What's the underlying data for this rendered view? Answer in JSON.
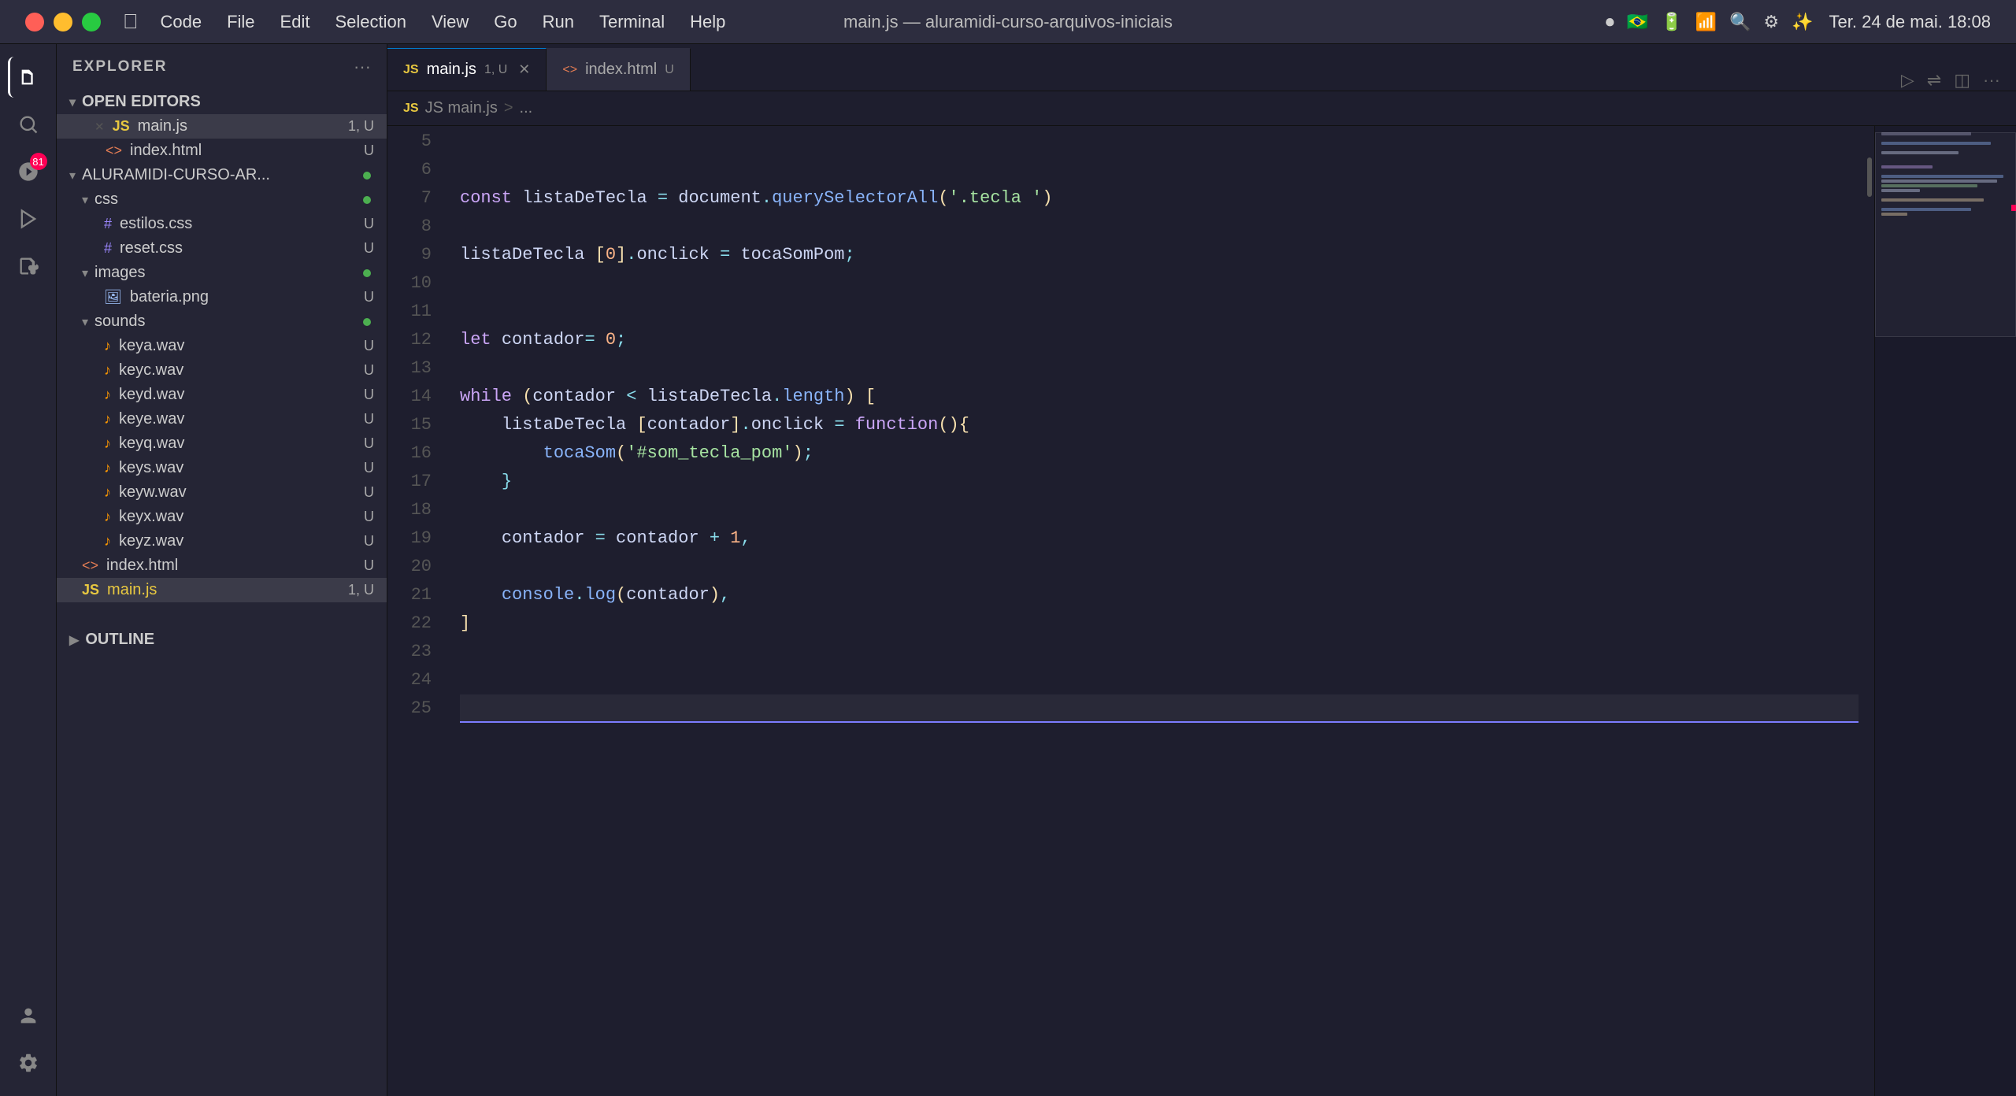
{
  "titlebar": {
    "title": "main.js — aluramidi-curso-arquivos-iniciais",
    "datetime": "Ter. 24 de mai.  18:08",
    "menu": [
      "",
      "Code",
      "File",
      "Edit",
      "Selection",
      "View",
      "Go",
      "Run",
      "Terminal",
      "Help"
    ]
  },
  "tabs": [
    {
      "id": "main-js",
      "label": "main.js",
      "badge": "1, U",
      "active": true,
      "closeable": true,
      "icon": "JS"
    },
    {
      "id": "index-html",
      "label": "index.html",
      "badge": "U",
      "active": false,
      "closeable": false,
      "icon": "HTML"
    }
  ],
  "breadcrumb": {
    "items": [
      "JS main.js",
      ">",
      "..."
    ]
  },
  "sidebar": {
    "title": "EXPLORER",
    "sections": {
      "open_editors": {
        "label": "OPEN EDITORS",
        "files": [
          {
            "name": "main.js",
            "badge": "1, U",
            "icon": "JS",
            "active": true
          },
          {
            "name": "index.html",
            "badge": "U",
            "icon": "HTML"
          }
        ]
      },
      "project": {
        "label": "ALURAMIDI-CURSO-AR...",
        "folders": [
          {
            "name": "css",
            "level": 1,
            "dot": "green",
            "children": [
              {
                "name": "estilos.css",
                "badge": "U",
                "icon": "CSS"
              },
              {
                "name": "reset.css",
                "badge": "U",
                "icon": "CSS"
              }
            ]
          },
          {
            "name": "images",
            "level": 1,
            "dot": "green",
            "children": [
              {
                "name": "bateria.png",
                "badge": "U",
                "icon": "IMG"
              }
            ]
          },
          {
            "name": "sounds",
            "level": 1,
            "dot": "green",
            "children": [
              {
                "name": "keya.wav",
                "badge": "U",
                "icon": "AUDIO"
              },
              {
                "name": "keyc.wav",
                "badge": "U",
                "icon": "AUDIO"
              },
              {
                "name": "keyd.wav",
                "badge": "U",
                "icon": "AUDIO"
              },
              {
                "name": "keye.wav",
                "badge": "U",
                "icon": "AUDIO"
              },
              {
                "name": "keyq.wav",
                "badge": "U",
                "icon": "AUDIO"
              },
              {
                "name": "keys.wav",
                "badge": "U",
                "icon": "AUDIO"
              },
              {
                "name": "keyw.wav",
                "badge": "U",
                "icon": "AUDIO"
              },
              {
                "name": "keyx.wav",
                "badge": "U",
                "icon": "AUDIO"
              },
              {
                "name": "keyz.wav",
                "badge": "U",
                "icon": "AUDIO"
              }
            ]
          },
          {
            "name": "index.html",
            "level": 0,
            "badge": "U",
            "icon": "HTML"
          },
          {
            "name": "main.js",
            "level": 0,
            "badge": "1, U",
            "icon": "JS",
            "active": true
          }
        ]
      }
    }
  },
  "code": {
    "lines": [
      {
        "num": 5,
        "content": ""
      },
      {
        "num": 6,
        "content": ""
      },
      {
        "num": 7,
        "tokens": [
          {
            "t": "kw",
            "v": "const "
          },
          {
            "t": "var",
            "v": "listaDeTecla "
          },
          {
            "t": "op",
            "v": "= "
          },
          {
            "t": "var",
            "v": "document"
          },
          {
            "t": "op",
            "v": "."
          },
          {
            "t": "fn",
            "v": "querySelectorAll"
          },
          {
            "t": "bracket",
            "v": "("
          },
          {
            "t": "str",
            "v": "'.tecla '"
          },
          {
            "t": "bracket",
            "v": ")"
          }
        ]
      },
      {
        "num": 8,
        "content": ""
      },
      {
        "num": 9,
        "tokens": [
          {
            "t": "var",
            "v": "listaDeTecla "
          },
          {
            "t": "bracket",
            "v": "["
          },
          {
            "t": "num",
            "v": "0"
          },
          {
            "t": "bracket",
            "v": "]"
          },
          {
            "t": "op",
            "v": "."
          },
          {
            "t": "var",
            "v": "onclick "
          },
          {
            "t": "op",
            "v": "= "
          },
          {
            "t": "var",
            "v": "tocaSomPom"
          },
          {
            "t": "op",
            "v": ";"
          }
        ]
      },
      {
        "num": 10,
        "content": ""
      },
      {
        "num": 11,
        "content": ""
      },
      {
        "num": 12,
        "tokens": [
          {
            "t": "kw",
            "v": "let "
          },
          {
            "t": "var",
            "v": "contador"
          },
          {
            "t": "op",
            "v": "= "
          },
          {
            "t": "num",
            "v": "0"
          },
          {
            "t": "op",
            "v": ";"
          }
        ]
      },
      {
        "num": 13,
        "content": ""
      },
      {
        "num": 14,
        "tokens": [
          {
            "t": "kw",
            "v": "while "
          },
          {
            "t": "bracket",
            "v": "("
          },
          {
            "t": "var",
            "v": "contador "
          },
          {
            "t": "op",
            "v": "< "
          },
          {
            "t": "var",
            "v": "listaDeTecla"
          },
          {
            "t": "op",
            "v": "."
          },
          {
            "t": "prop",
            "v": "length"
          },
          {
            "t": "bracket",
            "v": ") "
          },
          {
            "t": "bracket",
            "v": "["
          }
        ]
      },
      {
        "num": 15,
        "tokens": [
          {
            "t": "var",
            "v": "    listaDeTecla "
          },
          {
            "t": "bracket",
            "v": "["
          },
          {
            "t": "var",
            "v": "contador"
          },
          {
            "t": "bracket",
            "v": "]"
          },
          {
            "t": "op",
            "v": "."
          },
          {
            "t": "var",
            "v": "onclick "
          },
          {
            "t": "op",
            "v": "= "
          },
          {
            "t": "kw",
            "v": "function"
          },
          {
            "t": "bracket",
            "v": "()"
          },
          {
            "t": "op",
            "v": "{"
          }
        ]
      },
      {
        "num": 16,
        "tokens": [
          {
            "t": "var",
            "v": "        "
          },
          {
            "t": "fn",
            "v": "tocaSom"
          },
          {
            "t": "bracket",
            "v": "("
          },
          {
            "t": "str",
            "v": "'#som_tecla_pom'"
          },
          {
            "t": "bracket",
            "v": ")"
          },
          {
            "t": "op",
            "v": ";"
          }
        ]
      },
      {
        "num": 17,
        "tokens": [
          {
            "t": "var",
            "v": "    "
          },
          {
            "t": "op",
            "v": "}"
          }
        ]
      },
      {
        "num": 18,
        "content": ""
      },
      {
        "num": 19,
        "tokens": [
          {
            "t": "var",
            "v": "    "
          },
          {
            "t": "var",
            "v": "contador "
          },
          {
            "t": "op",
            "v": "= "
          },
          {
            "t": "var",
            "v": "contador "
          },
          {
            "t": "op",
            "v": "+ "
          },
          {
            "t": "num",
            "v": "1"
          },
          {
            "t": "op",
            "v": ","
          }
        ]
      },
      {
        "num": 20,
        "content": ""
      },
      {
        "num": 21,
        "tokens": [
          {
            "t": "var",
            "v": "    "
          },
          {
            "t": "fn",
            "v": "console"
          },
          {
            "t": "op",
            "v": "."
          },
          {
            "t": "method",
            "v": "log"
          },
          {
            "t": "bracket",
            "v": "("
          },
          {
            "t": "var",
            "v": "contador"
          },
          {
            "t": "bracket",
            "v": ")"
          },
          {
            "t": "op",
            "v": ","
          }
        ]
      },
      {
        "num": 22,
        "tokens": [
          {
            "t": "bracket",
            "v": "]"
          }
        ]
      },
      {
        "num": 23,
        "content": ""
      },
      {
        "num": 24,
        "content": ""
      },
      {
        "num": 25,
        "content": "",
        "cursor": true
      }
    ]
  },
  "outline": {
    "label": "OUTLINE"
  }
}
